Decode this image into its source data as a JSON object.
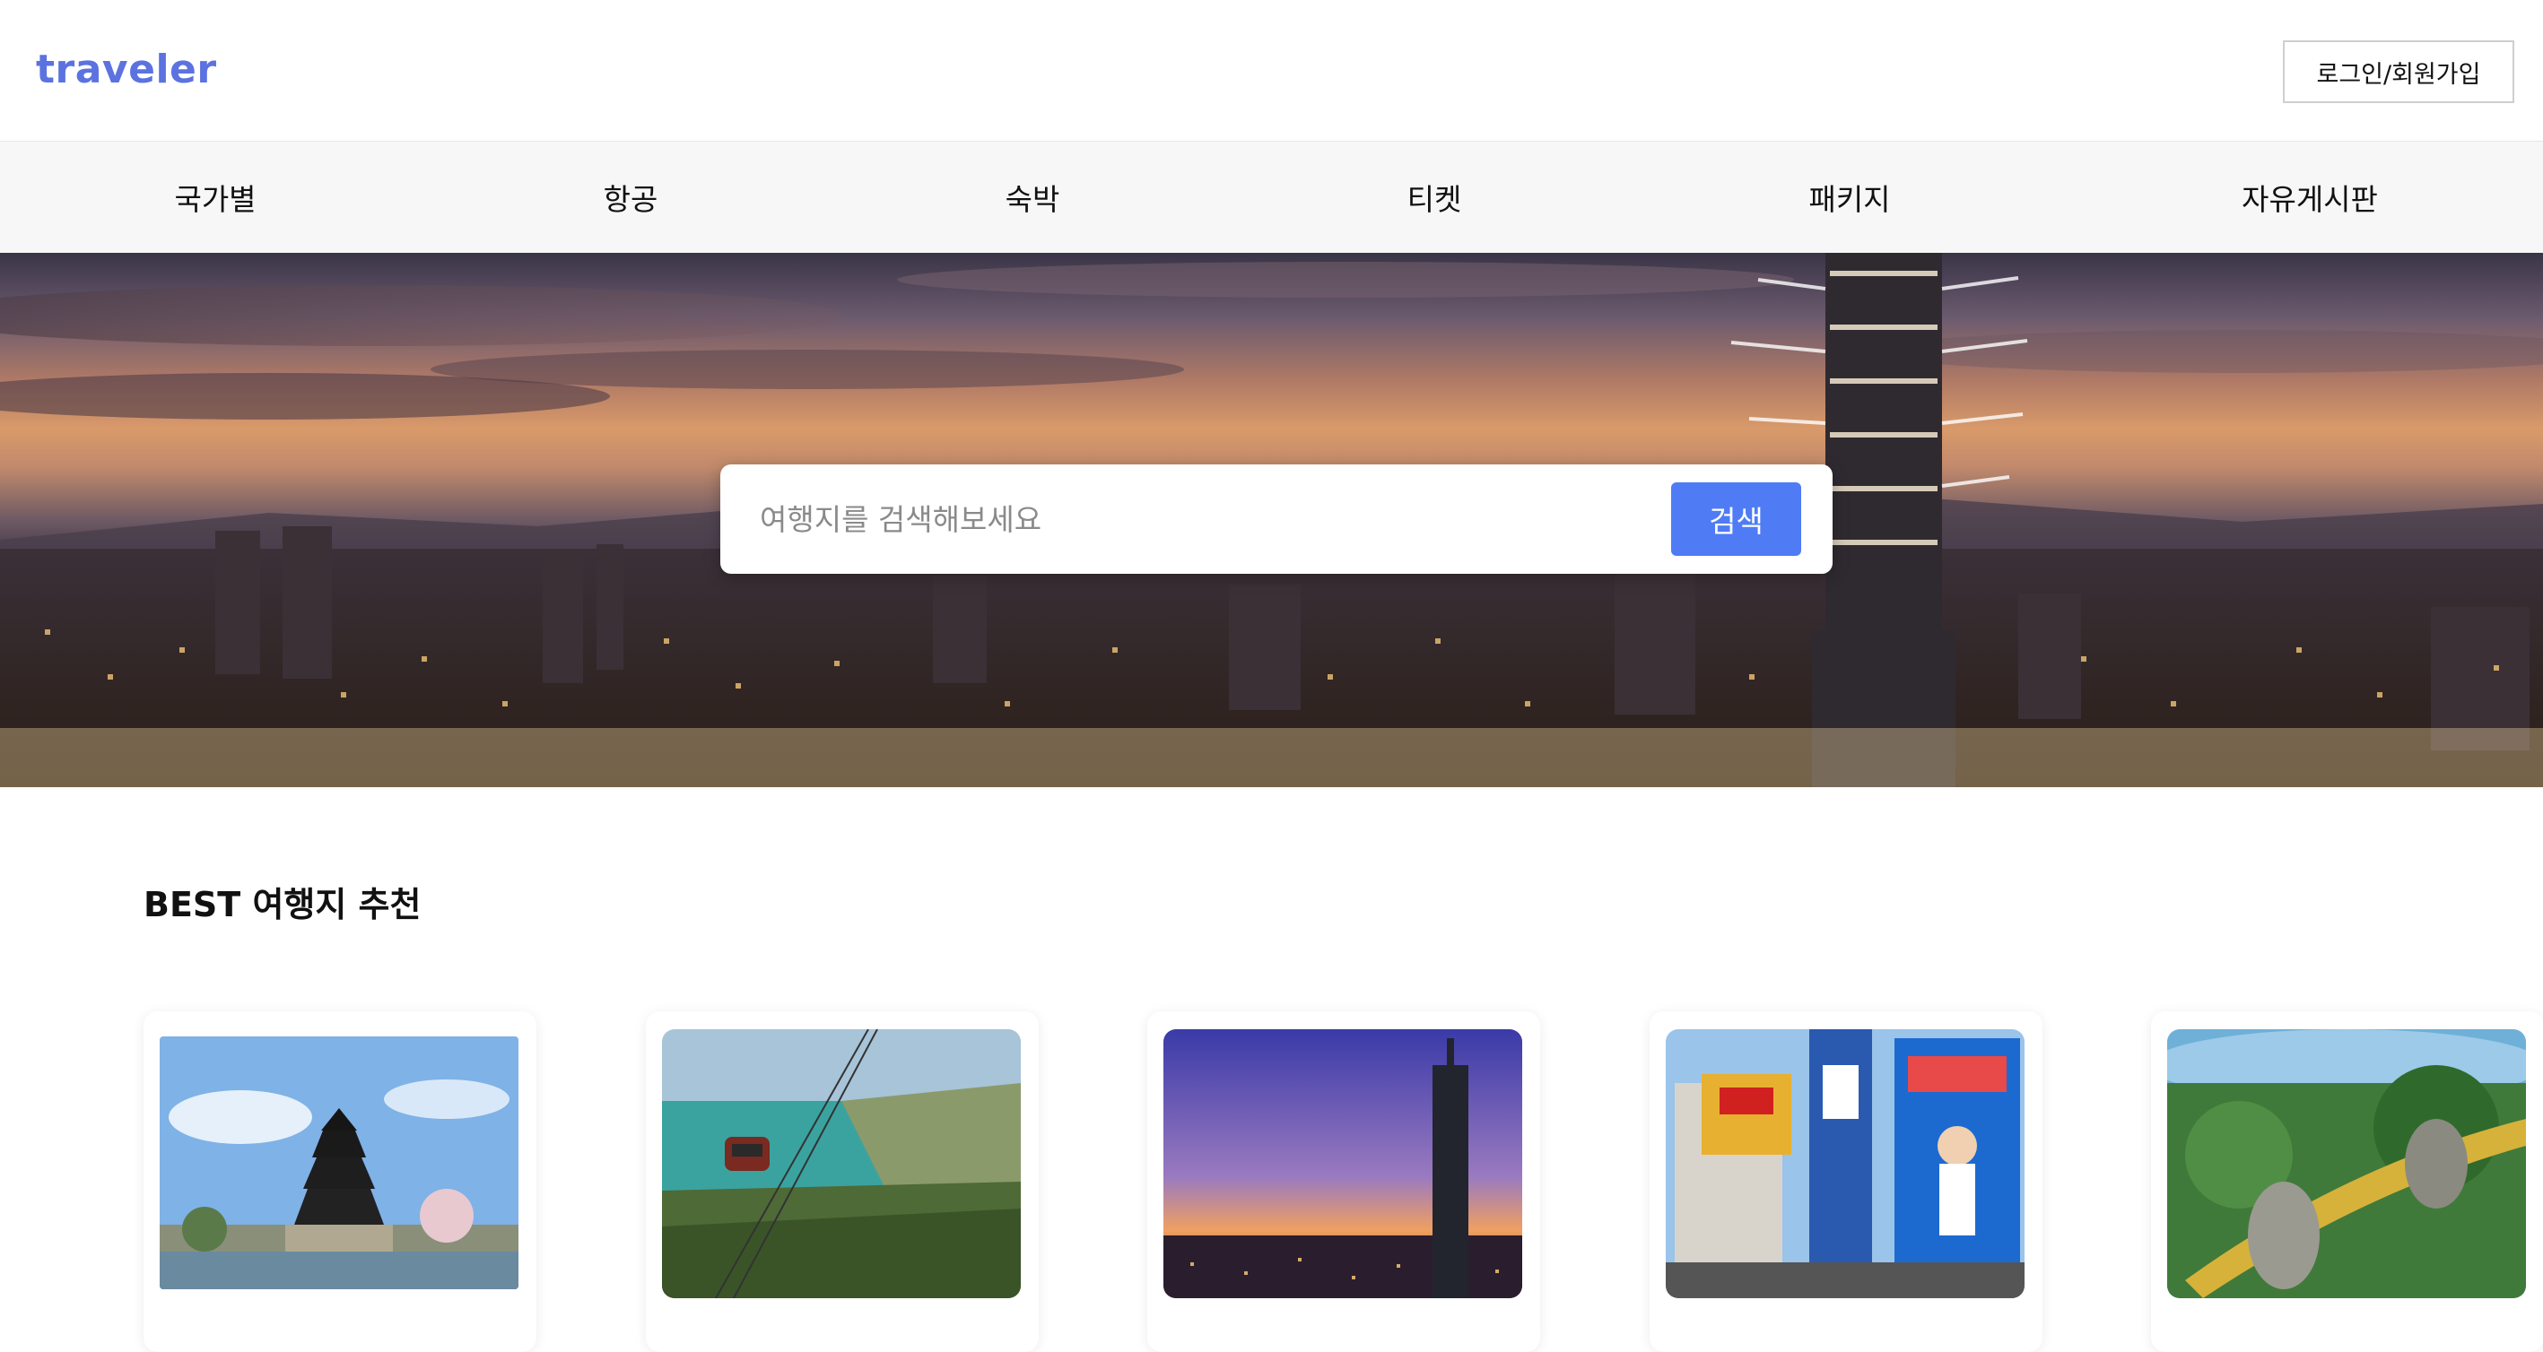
{
  "header": {
    "logo": "traveler",
    "login_label": "로그인/회원가입"
  },
  "nav": {
    "items": [
      {
        "label": "국가별"
      },
      {
        "label": "항공"
      },
      {
        "label": "숙박"
      },
      {
        "label": "티켓"
      },
      {
        "label": "패키지"
      },
      {
        "label": "자유게시판"
      }
    ]
  },
  "hero": {
    "search_placeholder": "여행지를 검색해보세요",
    "search_value": "",
    "search_button": "검색"
  },
  "best": {
    "title": "BEST 여행지 추천"
  },
  "colors": {
    "brand": "#5b72e0",
    "search_button": "#4f7cf5",
    "nav_background": "#f7f7f7"
  }
}
